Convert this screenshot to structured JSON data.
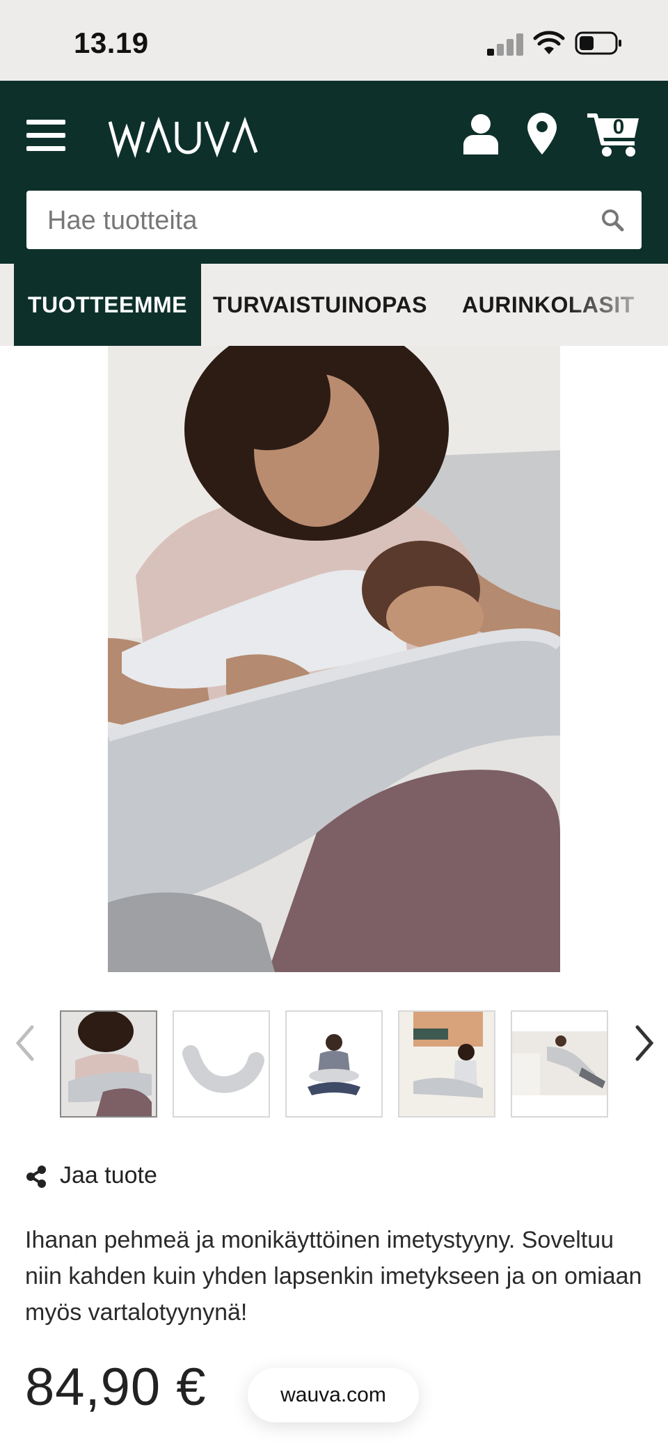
{
  "status_bar": {
    "time": "13.19"
  },
  "header": {
    "logo": "WAUVA",
    "cart_count": "0",
    "search_placeholder": "Hae tuotteita",
    "brand_color": "#0e302b"
  },
  "categories": [
    {
      "label": "TUOTTEEMME",
      "active": true
    },
    {
      "label": "TURVAISTUINOPAS",
      "active": false
    },
    {
      "label": "AURINKOLASIT",
      "active": false
    }
  ],
  "gallery": {
    "main_image": "mother-breastfeeding-with-nursing-pillow",
    "thumbnails": [
      {
        "icon": "thumb-mother-nursing",
        "active": true
      },
      {
        "icon": "thumb-pillow-product",
        "active": false
      },
      {
        "icon": "thumb-mother-sitting",
        "active": false
      },
      {
        "icon": "thumb-child-living-room",
        "active": false
      },
      {
        "icon": "thumb-woman-sleeping",
        "active": false
      }
    ]
  },
  "product": {
    "share_label": "Jaa tuote",
    "description": "Ihanan pehmeä ja monikäyttöinen imetystyyny. Soveltuu niin kahden kuin yhden lapsenkin imetykseen ja on omiaan myös vartalotyynynä!",
    "price": "84,90 €"
  },
  "browser": {
    "url": "wauva.com"
  }
}
